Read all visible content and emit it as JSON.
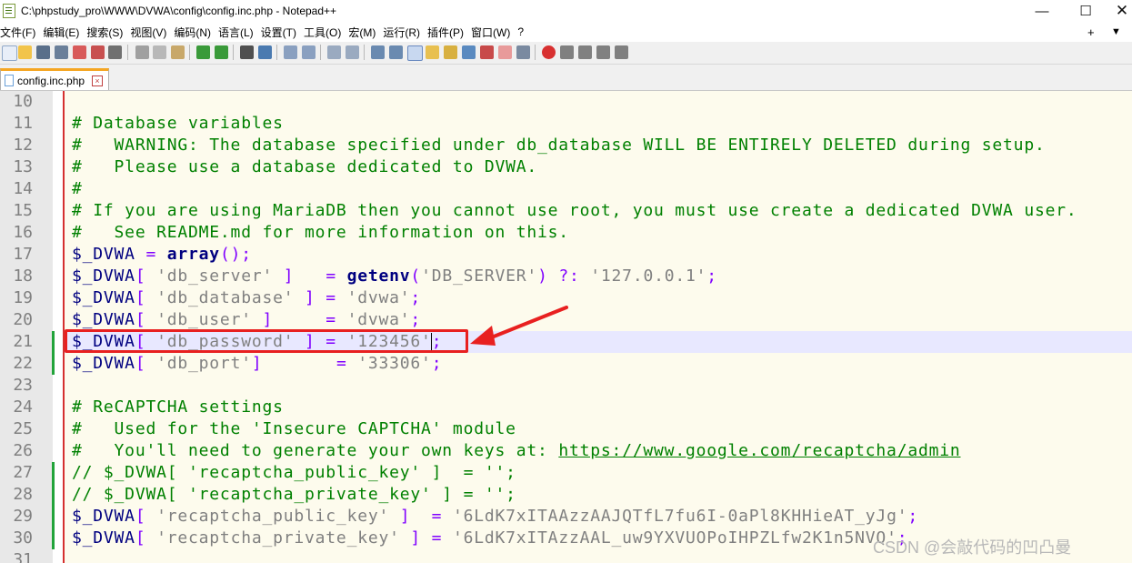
{
  "window": {
    "title": "C:\\phpstudy_pro\\WWW\\DVWA\\config\\config.inc.php - Notepad++",
    "minimize": "—",
    "maximize": "☐",
    "close": "✕"
  },
  "menu": {
    "items": [
      "文件(F)",
      "编辑(E)",
      "搜索(S)",
      "视图(V)",
      "编码(N)",
      "语言(L)",
      "设置(T)",
      "工具(O)",
      "宏(M)",
      "运行(R)",
      "插件(P)",
      "窗口(W)",
      "?"
    ],
    "plus": "+",
    "arrow": "▼"
  },
  "tab": {
    "label": "config.inc.php",
    "close": "×"
  },
  "editor": {
    "line_numbers": [
      "10",
      "11",
      "12",
      "13",
      "14",
      "15",
      "16",
      "17",
      "18",
      "19",
      "20",
      "21",
      "22",
      "23",
      "24",
      "25",
      "26",
      "27",
      "28",
      "29",
      "30",
      "31"
    ],
    "lines": {
      "l11": "# Database variables",
      "l12": "#   WARNING: The database specified under db_database WILL BE ENTIRELY DELETED during setup.",
      "l13": "#   Please use a database dedicated to DVWA.",
      "l14": "#",
      "l15": "# If you are using MariaDB then you cannot use root, you must use create a dedicated DVWA user.",
      "l16": "#   See README.md for more information on this.",
      "l17_var": "$_DVWA",
      "l17_op": " = ",
      "l17_func": "array",
      "l17_end": "();",
      "l18_var": "$_DVWA",
      "l18_b1": "[ ",
      "l18_key": "'db_server'",
      "l18_b2": " ]   ",
      "l18_eq": "= ",
      "l18_func": "getenv",
      "l18_p1": "(",
      "l18_env": "'DB_SERVER'",
      "l18_p2": ") ?: ",
      "l18_val": "'127.0.0.1'",
      "l18_end": ";",
      "l19_var": "$_DVWA",
      "l19_b1": "[ ",
      "l19_key": "'db_database'",
      "l19_b2": " ] = ",
      "l19_val": "'dvwa'",
      "l19_end": ";",
      "l20_var": "$_DVWA",
      "l20_b1": "[ ",
      "l20_key": "'db_user'",
      "l20_b2": " ]     = ",
      "l20_val": "'dvwa'",
      "l20_end": ";",
      "l21_var": "$_DVWA",
      "l21_b1": "[ ",
      "l21_key": "'db_password'",
      "l21_b2": " ] = ",
      "l21_val": "'123456'",
      "l21_end": ";",
      "l22_var": "$_DVWA",
      "l22_b1": "[ ",
      "l22_key": "'db_port'",
      "l22_b2": "]       = ",
      "l22_val": "'33306'",
      "l22_end": ";",
      "l24": "# ReCAPTCHA settings",
      "l25": "#   Used for the 'Insecure CAPTCHA' module",
      "l26_text": "#   You'll need to generate your own keys at: ",
      "l26_url": "https://www.google.com/recaptcha/admin",
      "l27": "// $_DVWA[ 'recaptcha_public_key' ]  = '';",
      "l28": "// $_DVWA[ 'recaptcha_private_key' ] = '';",
      "l29_var": "$_DVWA",
      "l29_b1": "[ ",
      "l29_key": "'recaptcha_public_key'",
      "l29_b2": " ]  = ",
      "l29_val": "'6LdK7xITAAzzAAJQTfL7fu6I-0aPl8KHHieAT_yJg'",
      "l29_end": ";",
      "l30_var": "$_DVWA",
      "l30_b1": "[ ",
      "l30_key": "'recaptcha_private_key'",
      "l30_b2": " ] = ",
      "l30_val": "'6LdK7xITAzzAAL_uw9YXVUOPoIHPZLfw2K1n5NVQ'",
      "l30_end": ";"
    }
  },
  "watermark": "CSDN @会敲代码的凹凸曼",
  "colors": {
    "comment": "#008000",
    "operator": "#8000ff",
    "string": "#808080",
    "keyword": "#000080",
    "highlight_box": "#e82020",
    "change_marker": "#22a33a"
  }
}
